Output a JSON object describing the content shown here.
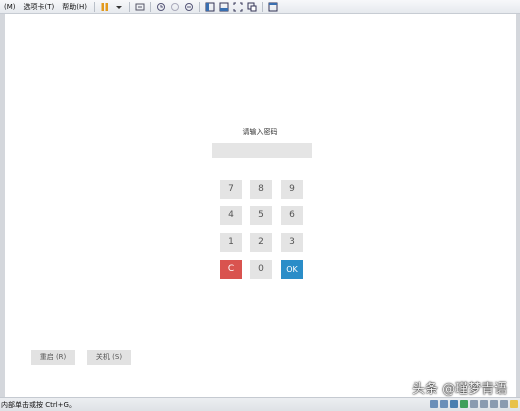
{
  "menu": {
    "items": [
      "(M)",
      "选项卡(T)",
      "帮助(H)"
    ]
  },
  "login": {
    "prompt": "请输入密码",
    "password_value": "",
    "keys": [
      "7",
      "8",
      "9",
      "4",
      "5",
      "6",
      "1",
      "2",
      "3",
      "C",
      "0",
      "OK"
    ]
  },
  "system": {
    "restart_label": "重启 (R)",
    "shutdown_label": "关机 (S)"
  },
  "status": {
    "text": "内部单击或按 Ctrl+G。"
  },
  "watermark": {
    "text": "头条 @瑾梦青语"
  },
  "colors": {
    "clear_key": "#d9534f",
    "ok_key": "#2a8dc8",
    "key_bg": "#e4e4e4"
  }
}
